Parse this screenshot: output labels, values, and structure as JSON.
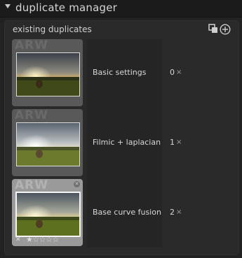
{
  "module": {
    "title": "duplicate manager"
  },
  "panel": {
    "label": "existing duplicates"
  },
  "thumb_watermark": "ARW",
  "duplicates": [
    {
      "label": "Basic settings",
      "version": "0",
      "delete": "×"
    },
    {
      "label": "Filmic + laplacian",
      "version": "1",
      "delete": "×"
    },
    {
      "label": "Base curve fusion",
      "version": "2",
      "delete": "×"
    }
  ],
  "active_thumb": {
    "reject": "✕",
    "rating_stars": "★☆☆☆☆"
  }
}
